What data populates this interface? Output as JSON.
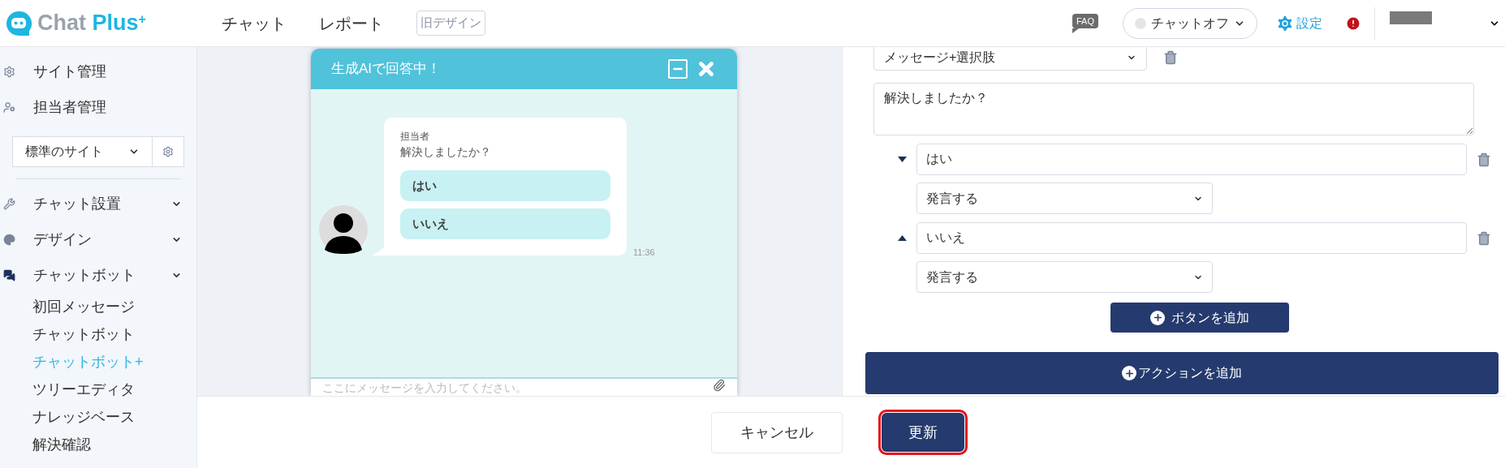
{
  "header": {
    "logo_text": "Chat",
    "logo_accent": "Plus",
    "logo_sup": "+",
    "nav": [
      {
        "label": "チャット"
      },
      {
        "label": "レポート"
      }
    ],
    "old_design_button": "旧デザイン",
    "faq": "FAQ",
    "status": {
      "label": "チャットオフ",
      "online": false
    },
    "settings": "設定"
  },
  "sidebar": {
    "top_items": [
      {
        "label": "サイト管理"
      },
      {
        "label": "担当者管理"
      }
    ],
    "site_select": "標準のサイト",
    "sections": [
      {
        "label": "チャット設置"
      },
      {
        "label": "デザイン"
      },
      {
        "label": "チャットボット",
        "children": [
          {
            "label": "初回メッセージ",
            "selected": false
          },
          {
            "label": "チャットボット",
            "selected": false
          },
          {
            "label": "チャットボット+",
            "selected": true
          },
          {
            "label": "ツリーエディタ",
            "selected": false
          },
          {
            "label": "ナレッジベース",
            "selected": false
          },
          {
            "label": "解決確認",
            "selected": false
          }
        ]
      }
    ]
  },
  "chat_widget": {
    "title": "生成AIで回答中！",
    "message": {
      "sender": "担当者",
      "text": "解決しましたか？",
      "choices": [
        "はい",
        "いいえ"
      ],
      "time": "11:36"
    },
    "input_placeholder": "ここにメッセージを入力してください。"
  },
  "editor": {
    "type_select": "メッセージ+選択肢",
    "message": "解決しましたか？",
    "options": [
      {
        "label": "はい",
        "action": "発言する"
      },
      {
        "label": "いいえ",
        "action": "発言する"
      }
    ],
    "add_button": "ボタンを追加",
    "add_action": "アクションを追加"
  },
  "footer": {
    "cancel": "キャンセル",
    "submit": {
      "label": "更新",
      "highlighted": true
    }
  }
}
